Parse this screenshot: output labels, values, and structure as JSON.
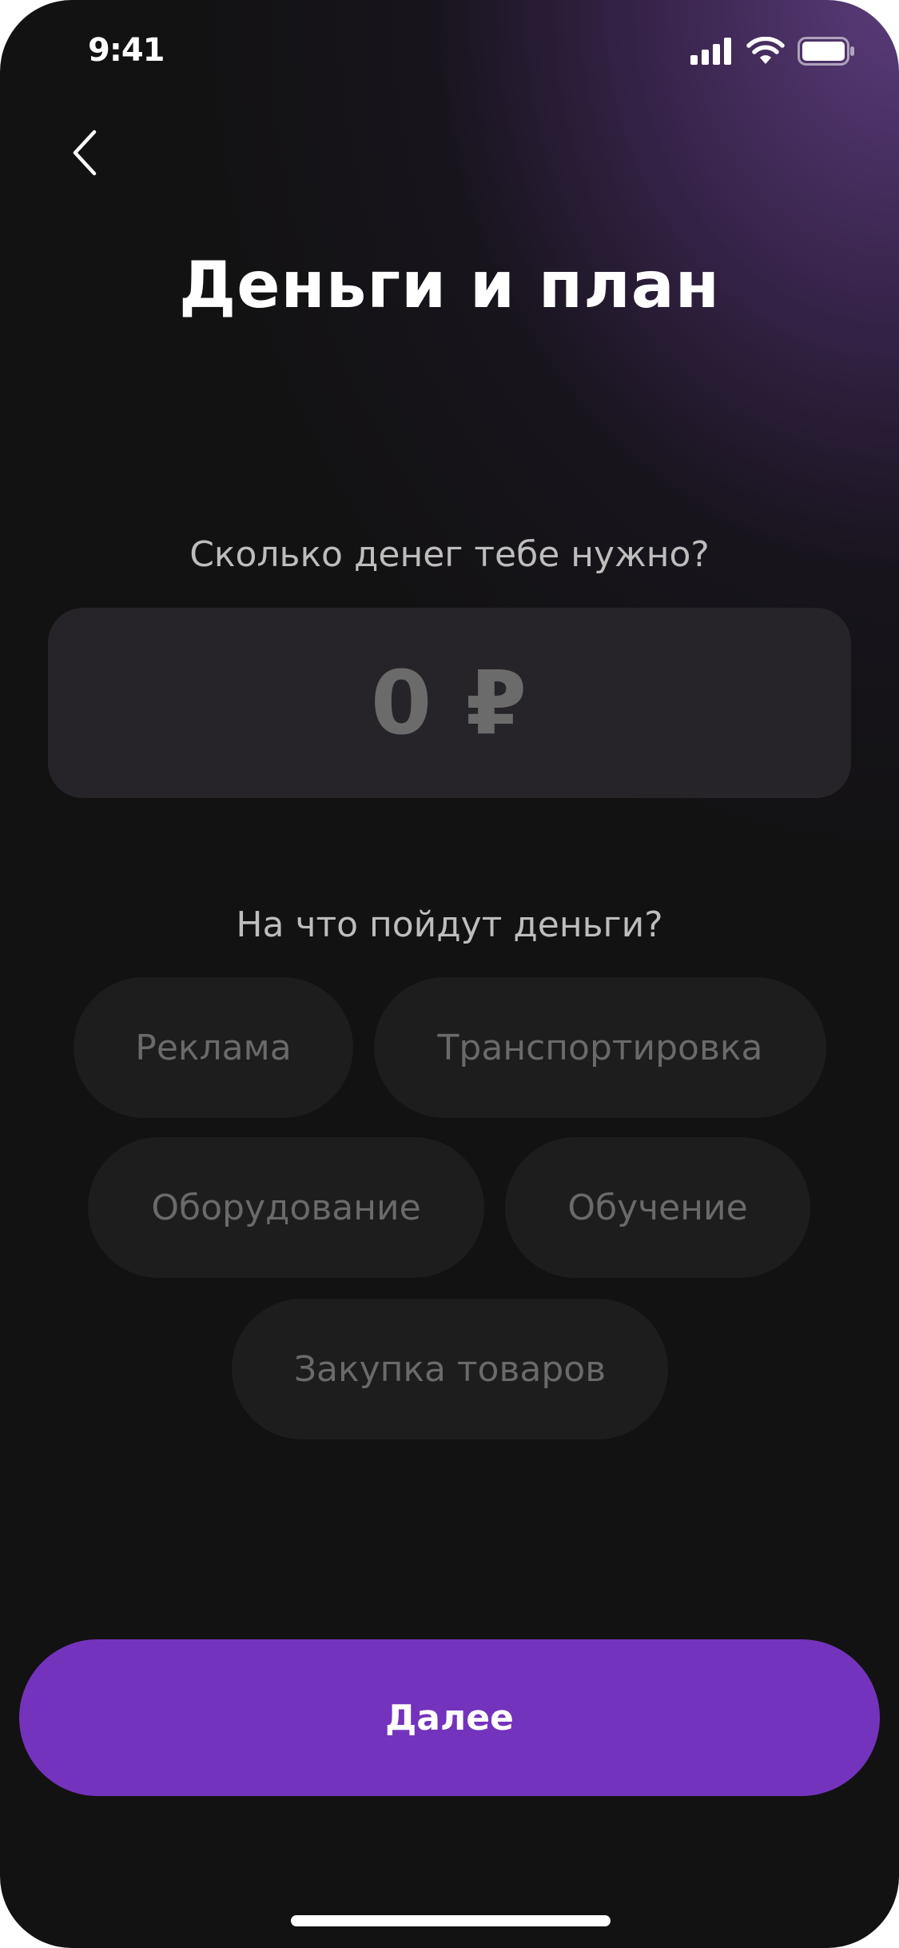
{
  "status_bar": {
    "time": "9:41",
    "signal_icon": "cellular-signal-icon",
    "wifi_icon": "wifi-icon",
    "battery_icon": "battery-icon"
  },
  "header": {
    "back_icon": "chevron-left-icon",
    "title": "Деньги и план"
  },
  "amount": {
    "label": "Сколько денег тебе нужно?",
    "value": "0 ₽"
  },
  "purpose": {
    "label": "На что пойдут деньги?",
    "options": [
      "Реклама",
      "Транспортировка",
      "Оборудование",
      "Обучение",
      "Закупка товаров"
    ]
  },
  "footer": {
    "next_label": "Далее"
  },
  "colors": {
    "background": "#121212",
    "accent_gradient": "#6e4696",
    "primary_button": "#7433bc",
    "chip_background": "#1d1d1d",
    "chip_text": "#6a6a6a",
    "label_text": "#bdbdbd"
  }
}
